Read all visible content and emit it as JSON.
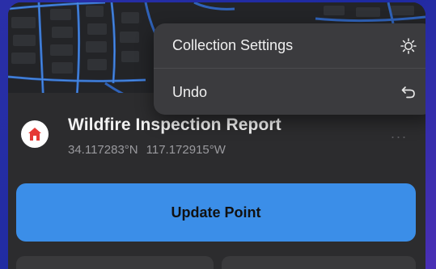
{
  "menu": {
    "items": [
      {
        "label": "Collection Settings",
        "icon": "gear-icon"
      },
      {
        "label": "Undo",
        "icon": "undo-arrow-icon"
      }
    ]
  },
  "record": {
    "title": "Wildfire Inspection Report",
    "latitude": "34.117283°N",
    "longitude": "117.172915°W",
    "icon": "house-icon",
    "icon_color": "#e53935",
    "more_label": "···"
  },
  "actions": {
    "update_label": "Update Point",
    "update_color": "#3b8ee8"
  },
  "colors": {
    "sheet_background": "#2c2c2e",
    "menu_background": "#3b3b3e",
    "map_road": "#3f7fd8"
  }
}
